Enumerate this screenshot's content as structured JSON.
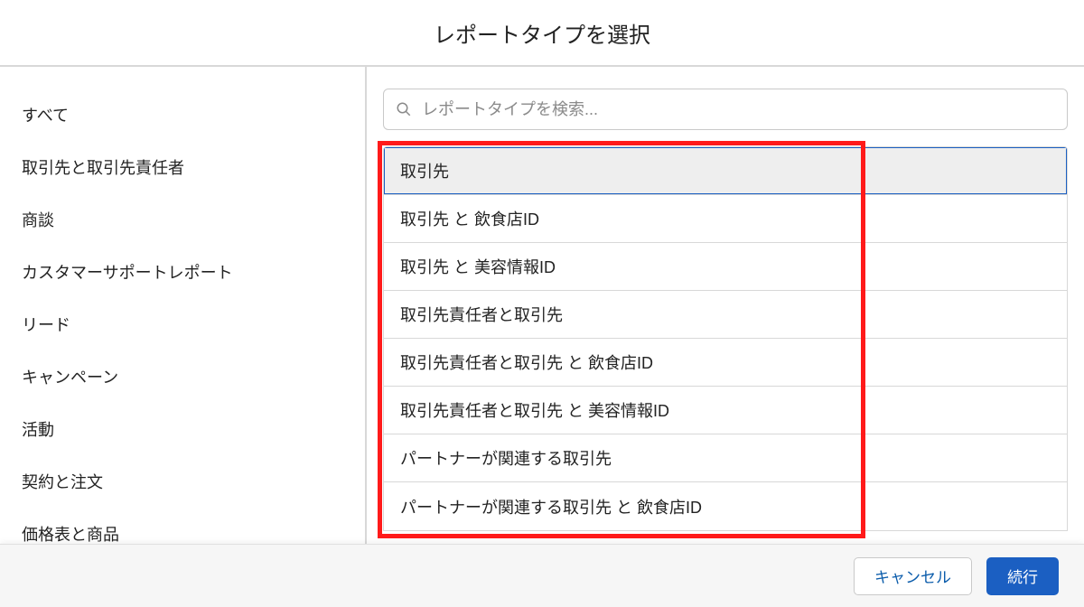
{
  "header": {
    "title": "レポートタイプを選択"
  },
  "sidebar": {
    "items": [
      {
        "label": "すべて"
      },
      {
        "label": "取引先と取引先責任者"
      },
      {
        "label": "商談"
      },
      {
        "label": "カスタマーサポートレポート"
      },
      {
        "label": "リード"
      },
      {
        "label": "キャンペーン"
      },
      {
        "label": "活動"
      },
      {
        "label": "契約と注文"
      },
      {
        "label": "価格表と商品"
      }
    ]
  },
  "search": {
    "placeholder": "レポートタイプを検索..."
  },
  "reportTypes": {
    "items": [
      {
        "label": "取引先",
        "selected": true
      },
      {
        "label": "取引先 と 飲食店ID"
      },
      {
        "label": "取引先 と 美容情報ID"
      },
      {
        "label": "取引先責任者と取引先"
      },
      {
        "label": "取引先責任者と取引先 と 飲食店ID"
      },
      {
        "label": "取引先責任者と取引先 と 美容情報ID"
      },
      {
        "label": "パートナーが関連する取引先"
      },
      {
        "label": "パートナーが関連する取引先 と 飲食店ID"
      }
    ]
  },
  "footer": {
    "cancel": "キャンセル",
    "continue": "続行"
  }
}
